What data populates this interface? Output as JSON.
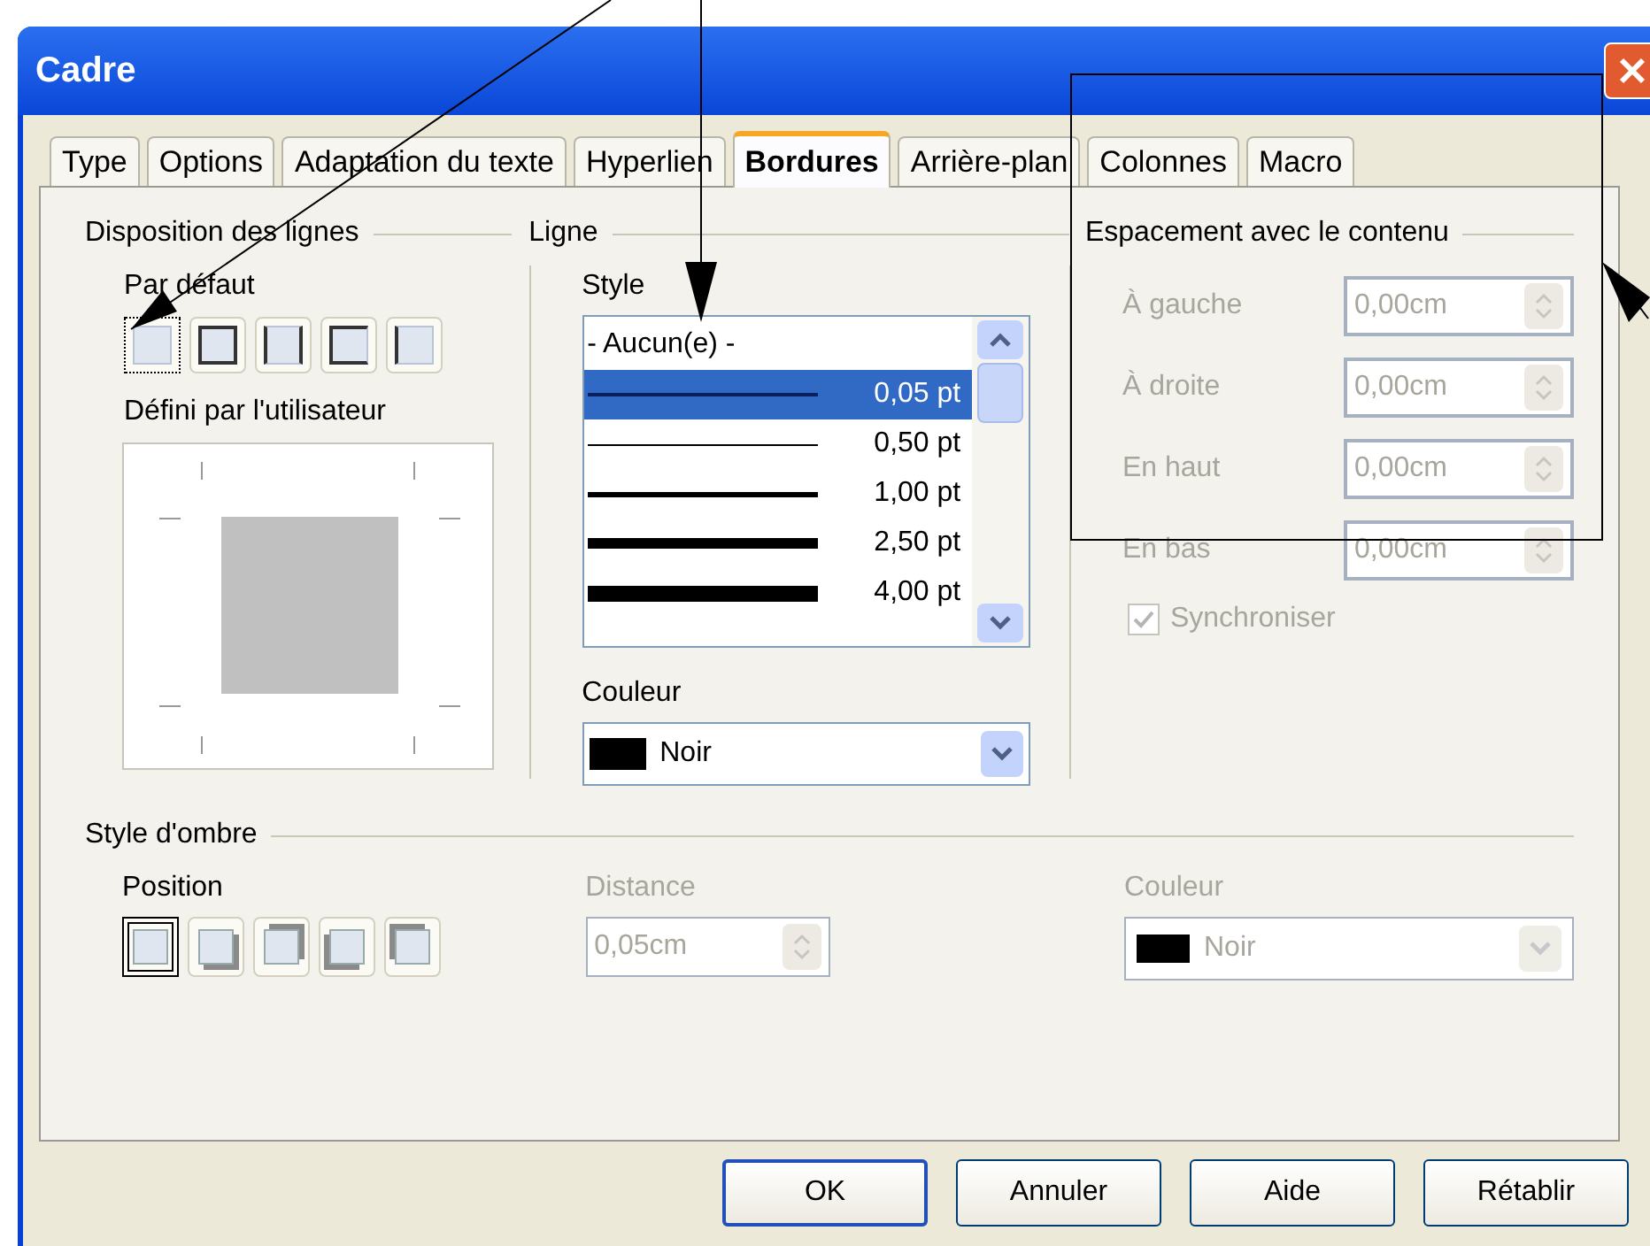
{
  "window": {
    "title": "Cadre"
  },
  "tabs": [
    {
      "label": "Type",
      "selected": false
    },
    {
      "label": "Options",
      "selected": false
    },
    {
      "label": "Adaptation du texte",
      "selected": false
    },
    {
      "label": "Hyperlien",
      "selected": false
    },
    {
      "label": "Bordures",
      "selected": true
    },
    {
      "label": "Arrière-plan",
      "selected": false
    },
    {
      "label": "Colonnes",
      "selected": false
    },
    {
      "label": "Macro",
      "selected": false
    }
  ],
  "line_arrangement": {
    "title": "Disposition des lignes",
    "default_label": "Par défaut",
    "presets": [
      {
        "kind": "none",
        "selected": true
      },
      {
        "kind": "box",
        "selected": false
      },
      {
        "kind": "left-right",
        "selected": false
      },
      {
        "kind": "top-bottom",
        "selected": false
      },
      {
        "kind": "left",
        "selected": false
      }
    ],
    "user_defined_label": "Défini par l'utilisateur"
  },
  "line": {
    "title": "Ligne",
    "style_label": "Style",
    "styles": [
      {
        "label": "- Aucun(e) -",
        "kind": "none",
        "selected": false
      },
      {
        "label": "0,05 pt",
        "kind": "hairline",
        "selected": true
      },
      {
        "label": "0,50 pt",
        "kind": "thin",
        "selected": false
      },
      {
        "label": "1,00 pt",
        "kind": "medium",
        "selected": false
      },
      {
        "label": "2,50 pt",
        "kind": "thick",
        "selected": false
      },
      {
        "label": "4,00 pt",
        "kind": "heavy",
        "selected": false
      }
    ],
    "color_label": "Couleur",
    "color": {
      "label": "Noir",
      "color": "#000000"
    }
  },
  "spacing": {
    "title": "Espacement avec le contenu",
    "disabled": true,
    "fields": [
      {
        "label": "À gauche",
        "value": "0,00cm"
      },
      {
        "label": "À droite",
        "value": "0,00cm"
      },
      {
        "label": "En haut",
        "value": "0,00cm"
      },
      {
        "label": "En bas",
        "value": "0,00cm"
      }
    ],
    "synchronize": {
      "label": "Synchroniser",
      "checked": true
    }
  },
  "shadow": {
    "title": "Style d'ombre",
    "position_label": "Position",
    "positions": [
      {
        "kind": "none",
        "selected": true
      },
      {
        "kind": "bottom-right",
        "selected": false
      },
      {
        "kind": "top-right",
        "selected": false
      },
      {
        "kind": "bottom-left",
        "selected": false
      },
      {
        "kind": "top-left",
        "selected": false
      }
    ],
    "distance": {
      "label": "Distance",
      "value": "0,05cm",
      "disabled": true
    },
    "color": {
      "label": "Couleur",
      "value": "Noir",
      "color": "#000000",
      "disabled": true
    }
  },
  "buttons": [
    {
      "label": "OK",
      "default": true
    },
    {
      "label": "Annuler",
      "default": false
    },
    {
      "label": "Aide",
      "default": false
    },
    {
      "label": "Rétablir",
      "default": false
    }
  ]
}
